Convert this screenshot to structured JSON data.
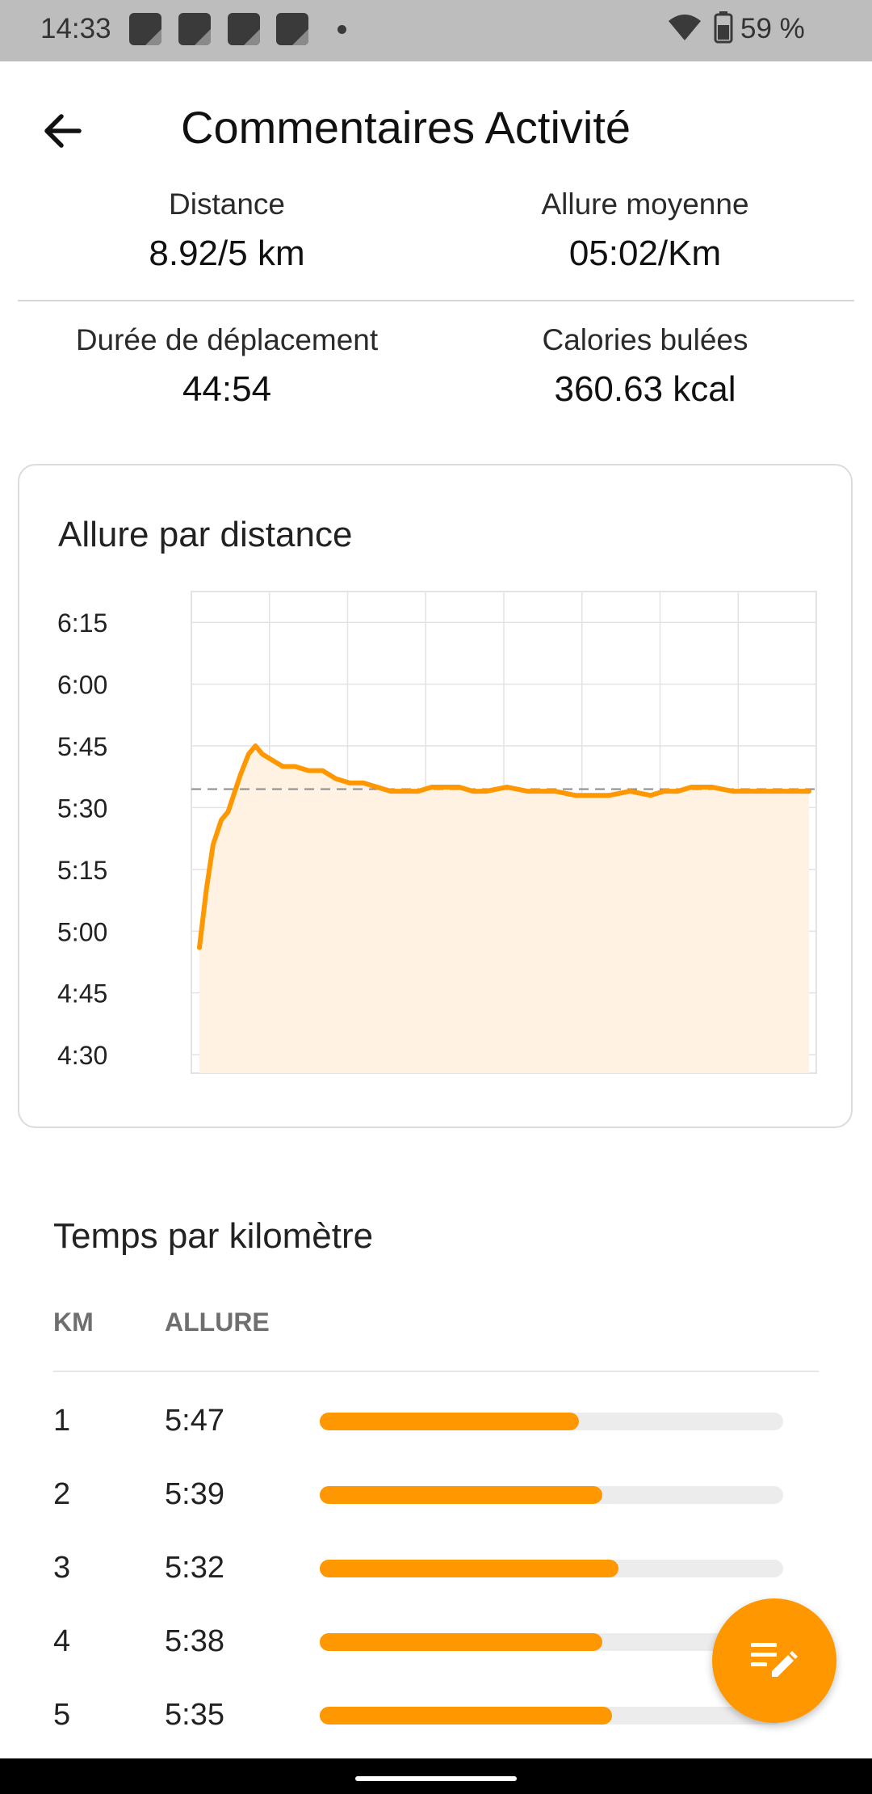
{
  "status_bar": {
    "time": "14:33",
    "battery": "59 %",
    "icons": [
      "notification-icon",
      "notification-icon",
      "notification-icon",
      "notification-icon",
      "wifi-icon",
      "battery-icon"
    ]
  },
  "header": {
    "title": "Commentaires Activité",
    "back_icon": "arrow-back-icon"
  },
  "stats": {
    "distance_label": "Distance",
    "distance_value": "8.92/5 km",
    "pace_label": "Allure moyenne",
    "pace_value": "05:02/Km",
    "duration_label": "Durée de déplacement",
    "duration_value": "44:54",
    "calories_label": "Calories bulées",
    "calories_value": "360.63 kcal"
  },
  "chart_card": {
    "title": "Allure par distance"
  },
  "chart_data": {
    "type": "area",
    "title": "Allure par distance",
    "y_tick_labels": [
      "6:15",
      "6:00",
      "5:45",
      "5:30",
      "5:15",
      "5:00",
      "4:45",
      "4:30"
    ],
    "y_ticks_min": [
      375,
      360,
      345,
      330,
      315,
      300,
      285,
      270
    ],
    "ylim_min": [
      265.5,
      382.5
    ],
    "xlim_km": [
      0,
      8.92
    ],
    "x_km": [
      0,
      0.1,
      0.2,
      0.32,
      0.42,
      0.5,
      0.6,
      0.72,
      0.82,
      0.92,
      1.02,
      1.12,
      1.22,
      1.4,
      1.6,
      1.8,
      2.0,
      2.2,
      2.4,
      2.6,
      2.8,
      3.0,
      3.2,
      3.4,
      3.6,
      3.8,
      4.0,
      4.2,
      4.5,
      4.8,
      5.0,
      5.2,
      5.5,
      5.8,
      6.0,
      6.3,
      6.6,
      6.8,
      7.0,
      7.2,
      7.5,
      7.8,
      8.0,
      8.3,
      8.6,
      8.8,
      8.92
    ],
    "y_pace_min": [
      296,
      310,
      321,
      327,
      329,
      333,
      338,
      343,
      345,
      343,
      342,
      341,
      340,
      340,
      339,
      339,
      337,
      336,
      336,
      335,
      334,
      334,
      334,
      335,
      335,
      335,
      334,
      334,
      335,
      334,
      334,
      334,
      333,
      333,
      333,
      334,
      333,
      334,
      334,
      335,
      335,
      334,
      334,
      334,
      334,
      334,
      334
    ],
    "reference_pace_min": 334.5,
    "colors": {
      "line": "#ff9800",
      "fill": "#fff2e3",
      "grid": "#e3e3e3",
      "reference": "#8a8a8a"
    }
  },
  "splits": {
    "title": "Temps par kilomètre",
    "col_km": "KM",
    "col_pace": "ALLURE",
    "rows": [
      {
        "km": "1",
        "pace": "5:47",
        "fill_fraction": 0.56
      },
      {
        "km": "2",
        "pace": "5:39",
        "fill_fraction": 0.61
      },
      {
        "km": "3",
        "pace": "5:32",
        "fill_fraction": 0.645
      },
      {
        "km": "4",
        "pace": "5:38",
        "fill_fraction": 0.61
      },
      {
        "km": "5",
        "pace": "5:35",
        "fill_fraction": 0.63
      }
    ]
  },
  "fab": {
    "icon": "edit-note-icon"
  },
  "colors": {
    "accent": "#ff9800",
    "status_bar": "#bdbdbd"
  }
}
